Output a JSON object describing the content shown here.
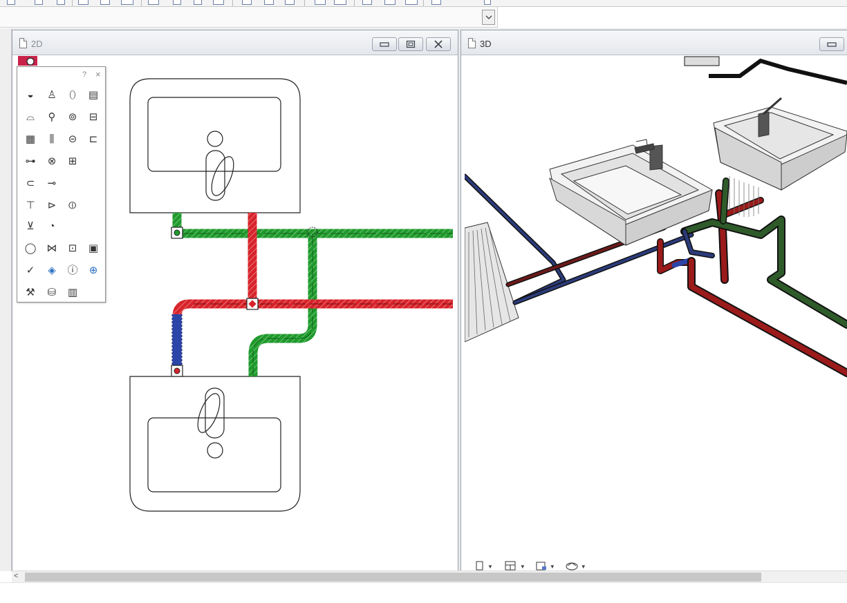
{
  "window_2d": {
    "title": "2D",
    "minimize": "▭",
    "maximize": "▢",
    "close": "✕"
  },
  "window_3d": {
    "title": "3D",
    "minimize": "▭"
  },
  "palette": {
    "help": "?",
    "close": "×",
    "icons": [
      "sink-icon",
      "toilet-icon",
      "urinal-icon",
      "cabinet-icon",
      "bathtub-icon",
      "tap-icon",
      "washing-machine-icon",
      "shower-tray-icon",
      "radiator-icon",
      "manifold-icon",
      "boiler-icon",
      "tank-icon",
      "pump-icon",
      "valve-pair-icon",
      "heat-exchanger-icon",
      "pipe-icon",
      "connect-arrow-icon",
      "tee-fitting-icon",
      "reducer-icon",
      "inline-fitting-icon",
      "shower-head-icon",
      "gauge-icon",
      "circle-fitting-icon",
      "butterfly-valve-icon",
      "meter-icon",
      "panel-icon",
      "check-icon",
      "layer-icon",
      "info-icon",
      "add-icon",
      "tool-icon",
      "database-add-icon",
      "report-add-icon"
    ]
  },
  "colors": {
    "supply_green": "#1f9a2c",
    "hot_red": "#d8232a",
    "cold_blue": "#2b45a8",
    "pipe3d_red": "#9b1b1b",
    "pipe3d_green": "#2f5a2a",
    "pipe3d_blue": "#2b3b7a",
    "window_border": "#9aa2ad",
    "palette_bg": "#ffffff"
  },
  "toolbar_3d": {
    "items": [
      "view-icon",
      "layout-icon",
      "camera-icon",
      "render-icon"
    ]
  },
  "scrollbar": {
    "left_arrow": "<"
  }
}
